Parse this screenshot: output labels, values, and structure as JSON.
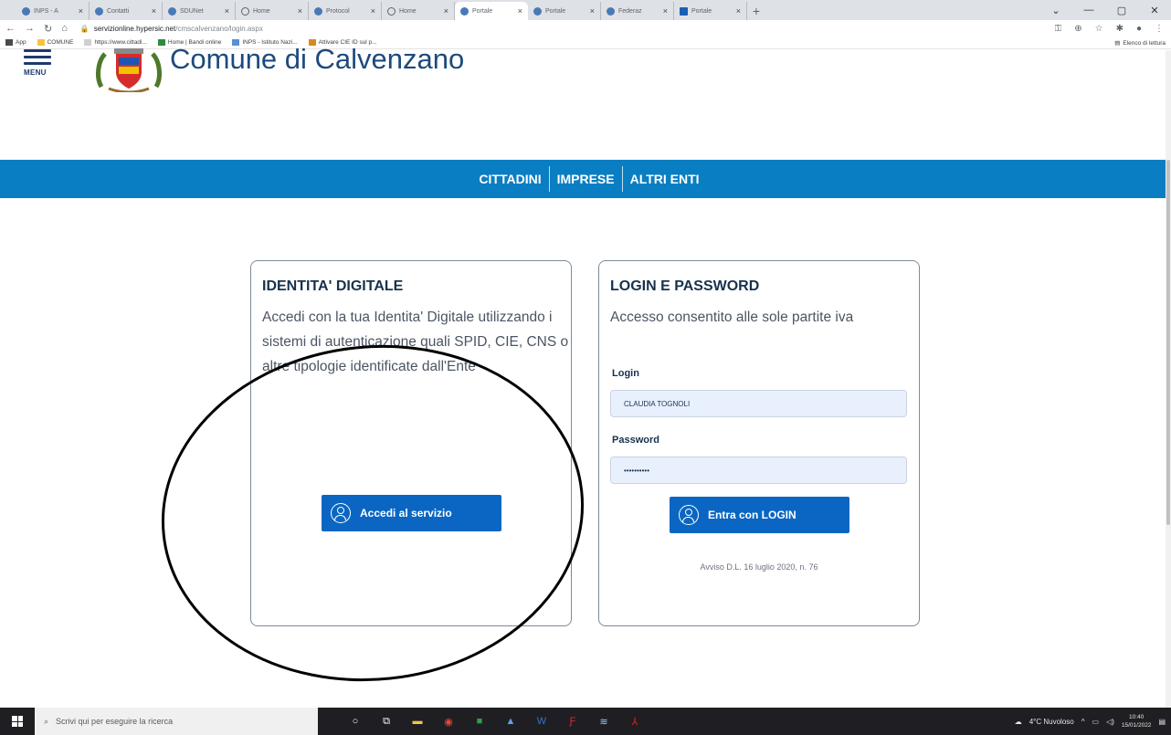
{
  "browser": {
    "tabs": [
      {
        "title": "INPS - A",
        "icon": "inps-icon",
        "active": false
      },
      {
        "title": "Contatti",
        "icon": "comune-icon",
        "active": false
      },
      {
        "title": "SDUNet",
        "icon": "comune-icon",
        "active": false
      },
      {
        "title": "Home",
        "icon": "globe-icon",
        "active": false
      },
      {
        "title": "Protocol",
        "icon": "comune-icon",
        "active": false
      },
      {
        "title": "Home",
        "icon": "globe-icon",
        "active": false
      },
      {
        "title": "Portale",
        "icon": "comune-icon",
        "active": true
      },
      {
        "title": "Portale",
        "icon": "comune-icon",
        "active": false
      },
      {
        "title": "Federaz",
        "icon": "blank-icon",
        "active": false
      },
      {
        "title": "Portale",
        "icon": "square-icon",
        "active": false
      }
    ],
    "url_host": "servizionline.hypersic.net",
    "url_path": "/cmscalvenzano/login.aspx",
    "bookmarks": [
      {
        "label": "App",
        "icon": "apps-icon"
      },
      {
        "label": "COMUNE",
        "icon": "folder-icon"
      },
      {
        "label": "https://www.cittadi...",
        "icon": "blank-icon"
      },
      {
        "label": "Home | Bandi online",
        "icon": "green-square-icon"
      },
      {
        "label": "INPS - Istituto Nazi...",
        "icon": "inps-icon"
      },
      {
        "label": "Attivare CIE ID sul p...",
        "icon": "cie-icon"
      }
    ],
    "reading_list": "Elenco di lettura"
  },
  "site": {
    "menu_label": "MENU",
    "title": "Comune di Calvenzano",
    "nav": [
      "CITTADINI",
      "IMPRESE",
      "ALTRI ENTI"
    ]
  },
  "cards": {
    "spid": {
      "heading": "IDENTITA' DIGITALE",
      "description": "Accedi con la tua Identita' Digitale utilizzando i sistemi di autenticazione quali SPID, CIE, CNS o altre tipologie identificate dall'Ente",
      "button": "Accedi al servizio"
    },
    "login": {
      "heading": "LOGIN E PASSWORD",
      "description": "Accesso consentito alle sole partite iva",
      "login_label": "Login",
      "login_value": "CLAUDIA TOGNOLI",
      "password_label": "Password",
      "password_value": "••••••••••",
      "button": "Entra con LOGIN",
      "notice": "Avviso D.L. 16 luglio 2020, n. 76"
    }
  },
  "taskbar": {
    "search_placeholder": "Scrivi qui per eseguire la ricerca",
    "weather": "4°C Nuvoloso",
    "time": "10:40",
    "date": "15/01/2022"
  },
  "colors": {
    "nav_blue": "#0a7ec2",
    "button_blue": "#0a66c2",
    "title_blue": "#1c4a7d"
  }
}
